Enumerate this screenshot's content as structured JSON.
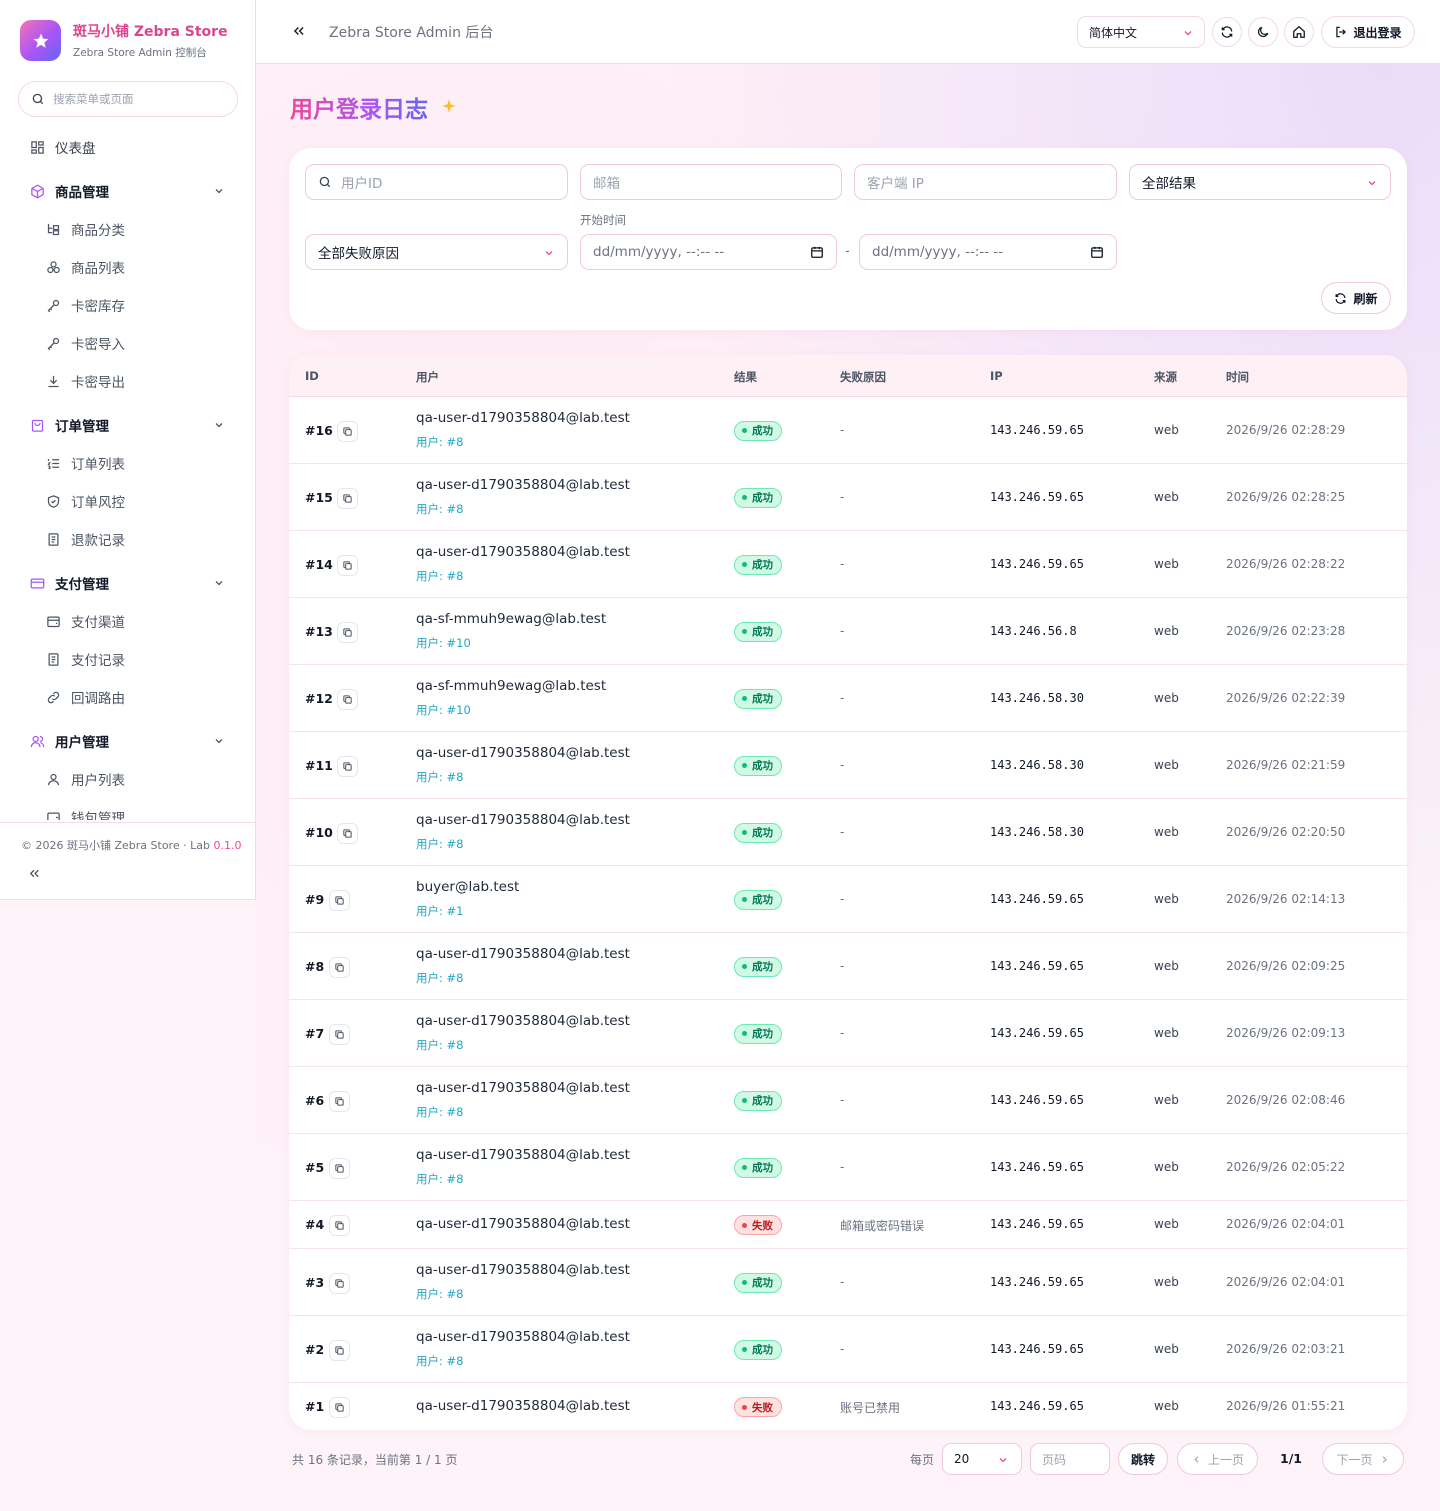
{
  "brand": {
    "title": "斑马小铺 Zebra Store",
    "subtitle": "Zebra Store Admin 控制台"
  },
  "sidebar": {
    "search_placeholder": "搜索菜单或页面",
    "dashboard": "仪表盘",
    "groups": [
      {
        "label": "商品管理",
        "items": [
          "商品分类",
          "商品列表",
          "卡密库存",
          "卡密导入",
          "卡密导出"
        ]
      },
      {
        "label": "订单管理",
        "items": [
          "订单列表",
          "订单风控",
          "退款记录"
        ]
      },
      {
        "label": "支付管理",
        "items": [
          "支付渠道",
          "支付记录",
          "回调路由"
        ]
      },
      {
        "label": "用户管理",
        "items": [
          "用户列表",
          "钱包管理"
        ]
      }
    ],
    "footer_copy": "© 2026 斑马小铺 Zebra Store · Lab ",
    "footer_version": "0.1.0"
  },
  "header": {
    "title": "Zebra Store Admin 后台",
    "language": "简体中文",
    "logout": "退出登录"
  },
  "page": {
    "title": "用户登录日志"
  },
  "filters": {
    "user_id_placeholder": "用户ID",
    "email_placeholder": "邮箱",
    "ip_placeholder": "客户端 IP",
    "result_value": "全部结果",
    "reason_value": "全部失败原因",
    "start_label": "开始时间",
    "start_value": "dd/mm/yyyy, --:-- --",
    "end_value": "dd/mm/yyyy, --:-- --",
    "range_sep": "-",
    "refresh": "刷新"
  },
  "table": {
    "headers": {
      "id": "ID",
      "user": "用户",
      "result": "结果",
      "reason": "失败原因",
      "ip": "IP",
      "source": "来源",
      "time": "时间"
    },
    "rows": [
      {
        "id": "#16",
        "email": "qa-user-d1790358804@lab.test",
        "uid": "用户: #8",
        "status": "ok",
        "result": "成功",
        "reason": "-",
        "ip": "143.246.59.65",
        "source": "web",
        "time": "2026/9/26 02:28:29"
      },
      {
        "id": "#15",
        "email": "qa-user-d1790358804@lab.test",
        "uid": "用户: #8",
        "status": "ok",
        "result": "成功",
        "reason": "-",
        "ip": "143.246.59.65",
        "source": "web",
        "time": "2026/9/26 02:28:25"
      },
      {
        "id": "#14",
        "email": "qa-user-d1790358804@lab.test",
        "uid": "用户: #8",
        "status": "ok",
        "result": "成功",
        "reason": "-",
        "ip": "143.246.59.65",
        "source": "web",
        "time": "2026/9/26 02:28:22"
      },
      {
        "id": "#13",
        "email": "qa-sf-mmuh9ewag@lab.test",
        "uid": "用户: #10",
        "status": "ok",
        "result": "成功",
        "reason": "-",
        "ip": "143.246.56.8",
        "source": "web",
        "time": "2026/9/26 02:23:28"
      },
      {
        "id": "#12",
        "email": "qa-sf-mmuh9ewag@lab.test",
        "uid": "用户: #10",
        "status": "ok",
        "result": "成功",
        "reason": "-",
        "ip": "143.246.58.30",
        "source": "web",
        "time": "2026/9/26 02:22:39"
      },
      {
        "id": "#11",
        "email": "qa-user-d1790358804@lab.test",
        "uid": "用户: #8",
        "status": "ok",
        "result": "成功",
        "reason": "-",
        "ip": "143.246.58.30",
        "source": "web",
        "time": "2026/9/26 02:21:59"
      },
      {
        "id": "#10",
        "email": "qa-user-d1790358804@lab.test",
        "uid": "用户: #8",
        "status": "ok",
        "result": "成功",
        "reason": "-",
        "ip": "143.246.58.30",
        "source": "web",
        "time": "2026/9/26 02:20:50"
      },
      {
        "id": "#9",
        "email": "buyer@lab.test",
        "uid": "用户: #1",
        "status": "ok",
        "result": "成功",
        "reason": "-",
        "ip": "143.246.59.65",
        "source": "web",
        "time": "2026/9/26 02:14:13"
      },
      {
        "id": "#8",
        "email": "qa-user-d1790358804@lab.test",
        "uid": "用户: #8",
        "status": "ok",
        "result": "成功",
        "reason": "-",
        "ip": "143.246.59.65",
        "source": "web",
        "time": "2026/9/26 02:09:25"
      },
      {
        "id": "#7",
        "email": "qa-user-d1790358804@lab.test",
        "uid": "用户: #8",
        "status": "ok",
        "result": "成功",
        "reason": "-",
        "ip": "143.246.59.65",
        "source": "web",
        "time": "2026/9/26 02:09:13"
      },
      {
        "id": "#6",
        "email": "qa-user-d1790358804@lab.test",
        "uid": "用户: #8",
        "status": "ok",
        "result": "成功",
        "reason": "-",
        "ip": "143.246.59.65",
        "source": "web",
        "time": "2026/9/26 02:08:46"
      },
      {
        "id": "#5",
        "email": "qa-user-d1790358804@lab.test",
        "uid": "用户: #8",
        "status": "ok",
        "result": "成功",
        "reason": "-",
        "ip": "143.246.59.65",
        "source": "web",
        "time": "2026/9/26 02:05:22"
      },
      {
        "id": "#4",
        "email": "qa-user-d1790358804@lab.test",
        "uid": "",
        "status": "fail",
        "result": "失败",
        "reason": "邮箱或密码错误",
        "ip": "143.246.59.65",
        "source": "web",
        "time": "2026/9/26 02:04:01"
      },
      {
        "id": "#3",
        "email": "qa-user-d1790358804@lab.test",
        "uid": "用户: #8",
        "status": "ok",
        "result": "成功",
        "reason": "-",
        "ip": "143.246.59.65",
        "source": "web",
        "time": "2026/9/26 02:04:01"
      },
      {
        "id": "#2",
        "email": "qa-user-d1790358804@lab.test",
        "uid": "用户: #8",
        "status": "ok",
        "result": "成功",
        "reason": "-",
        "ip": "143.246.59.65",
        "source": "web",
        "time": "2026/9/26 02:03:21"
      },
      {
        "id": "#1",
        "email": "qa-user-d1790358804@lab.test",
        "uid": "",
        "status": "fail",
        "result": "失败",
        "reason": "账号已禁用",
        "ip": "143.246.59.65",
        "source": "web",
        "time": "2026/9/26 01:55:21"
      }
    ]
  },
  "pagination": {
    "summary": "共 16 条记录，当前第 1 / 1 页",
    "per_page_label": "每页",
    "per_page_value": "20",
    "page_placeholder": "页码",
    "jump": "跳转",
    "prev": "上一页",
    "current": "1/1",
    "next": "下一页"
  },
  "colors": {
    "accent": "#ec4899",
    "accent_purple": "#a855f7",
    "success": "#10b981",
    "failure": "#ef4444",
    "uid": "#22a7c4"
  }
}
